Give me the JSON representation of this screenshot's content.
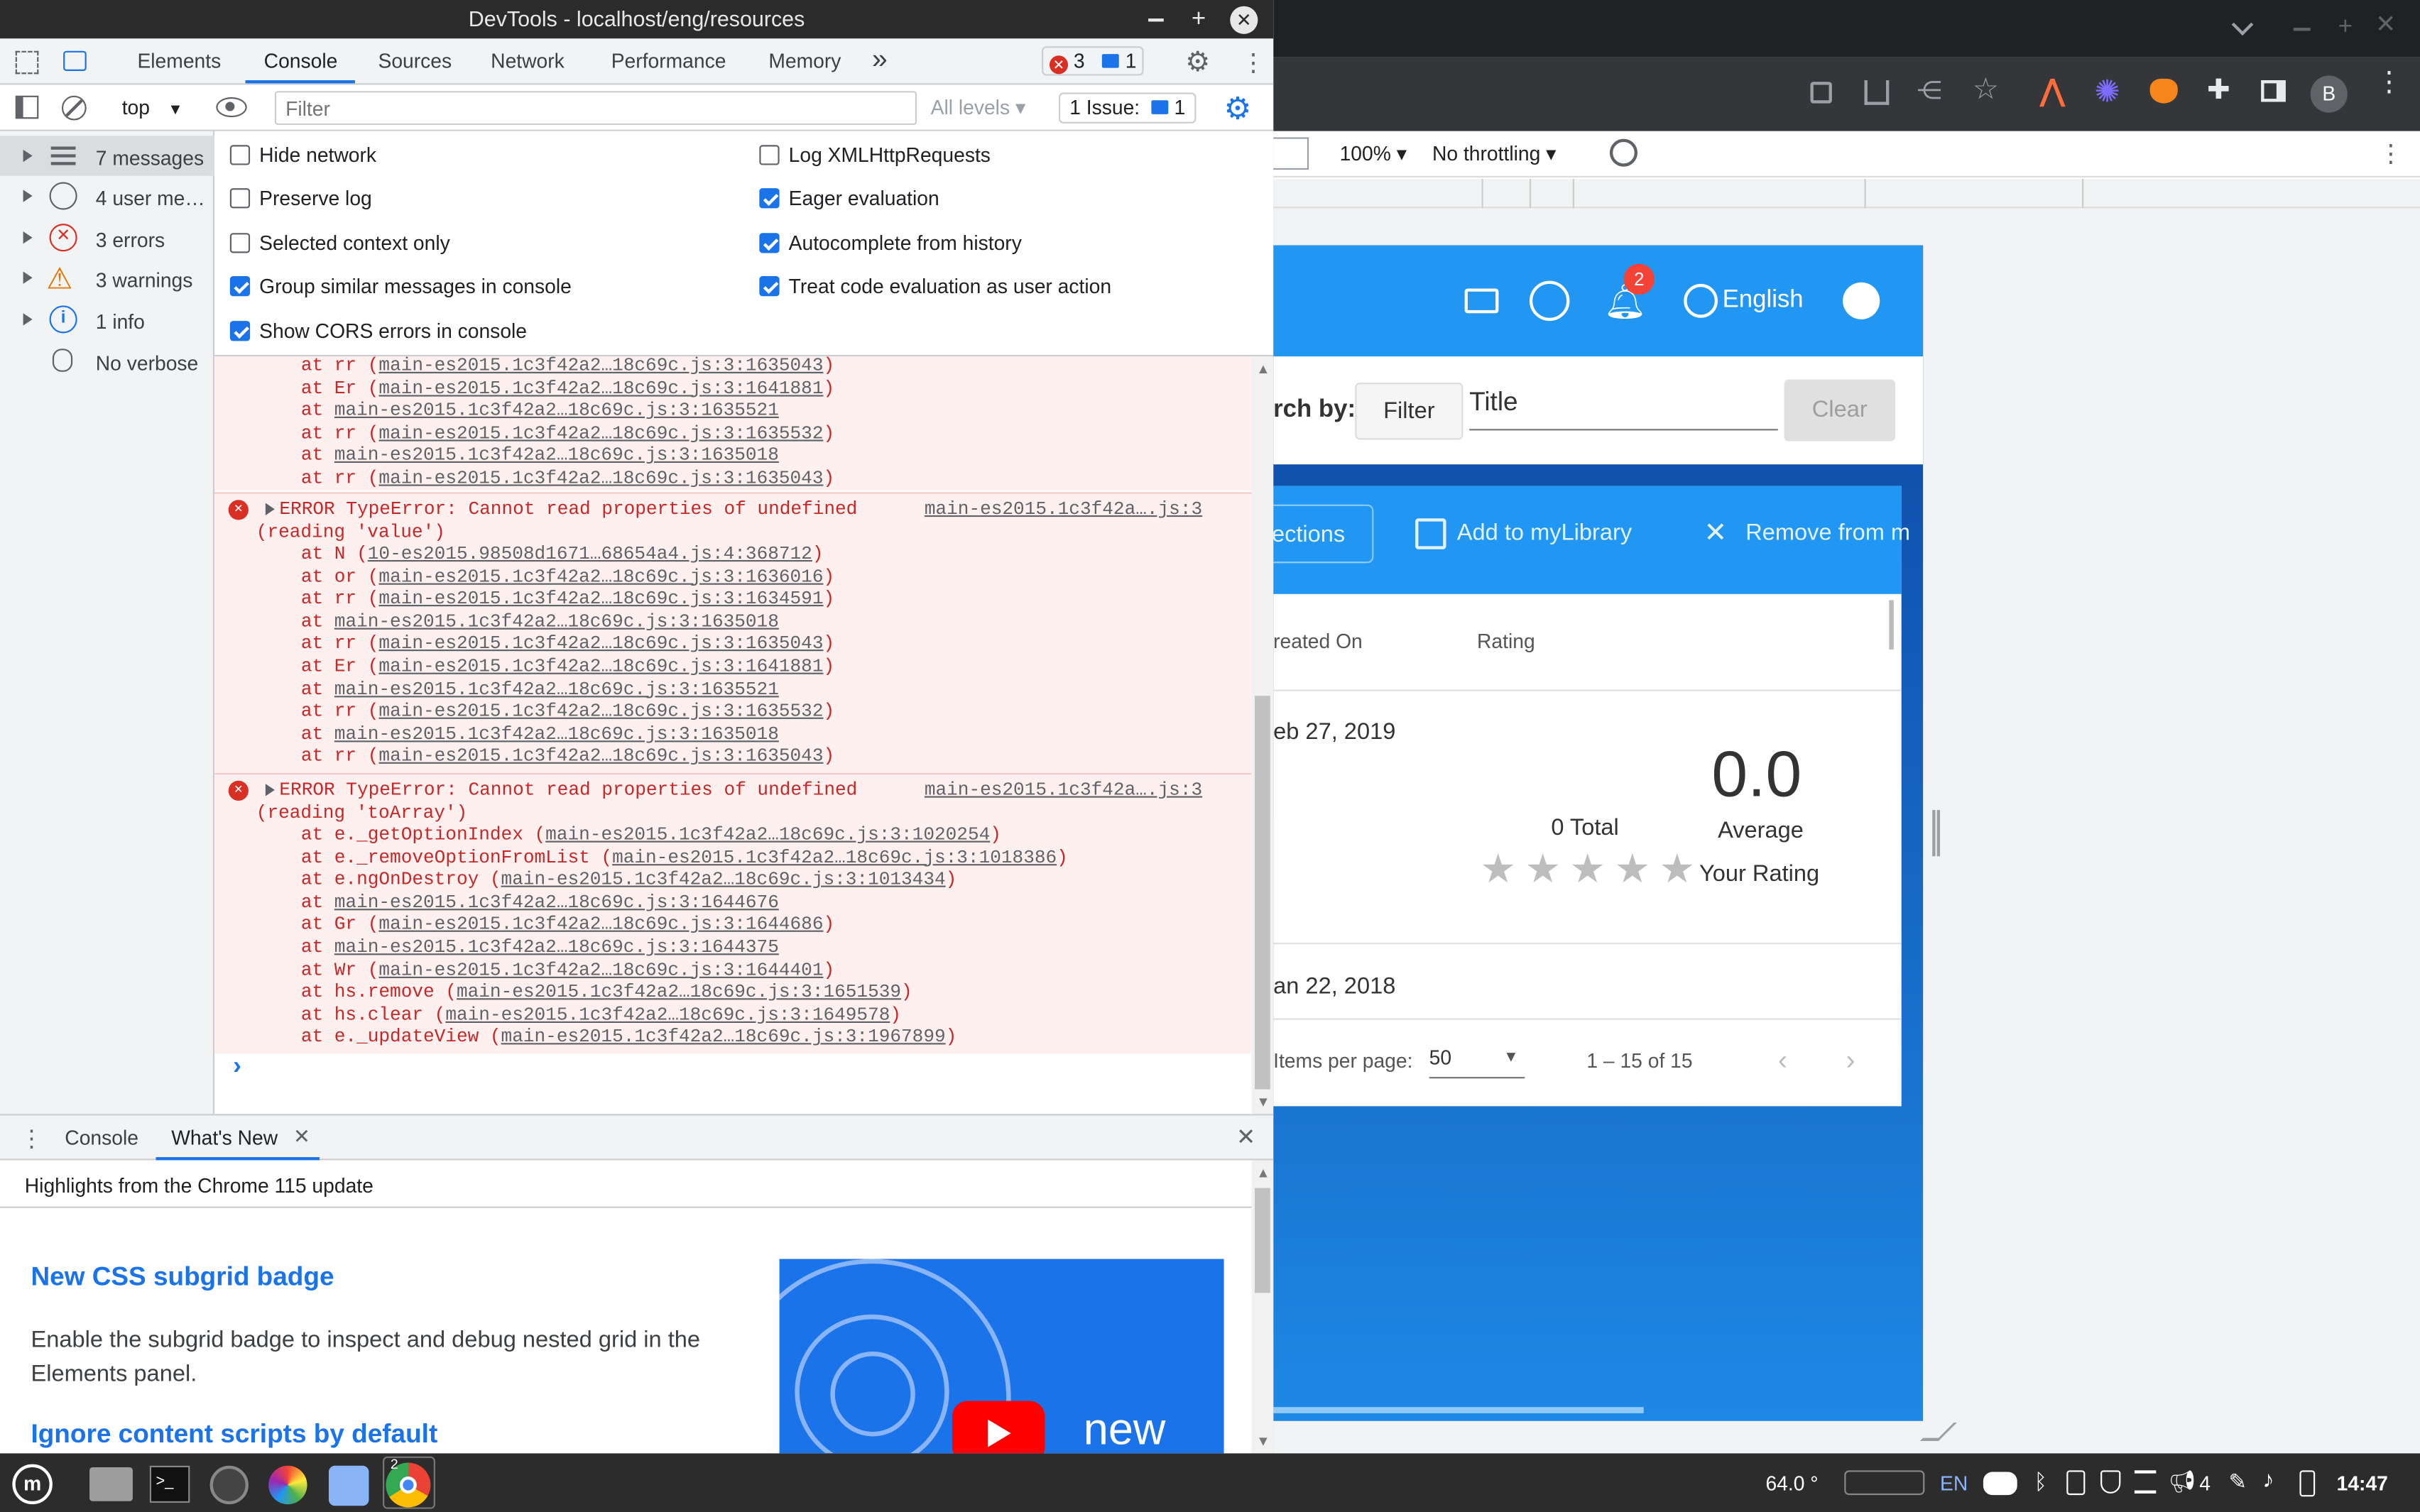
{
  "devtools": {
    "title": "DevTools - localhost/eng/resources",
    "tabs": [
      "Elements",
      "Console",
      "Sources",
      "Network",
      "Performance",
      "Memory"
    ],
    "active_tab": "Console",
    "more_tabs": "»",
    "error_count": "3",
    "message_count": "1",
    "context": "top",
    "filter_placeholder": "Filter",
    "levels": "All levels",
    "issues_label": "1 Issue:",
    "issues_count": "1",
    "sidebar": [
      {
        "label": "7 messages",
        "icon": "list-icon"
      },
      {
        "label": "4 user me…",
        "icon": "user-icon"
      },
      {
        "label": "3 errors",
        "icon": "error-icon"
      },
      {
        "label": "3 warnings",
        "icon": "warning-icon"
      },
      {
        "label": "1 info",
        "icon": "info-icon"
      },
      {
        "label": "No verbose",
        "icon": "bug-icon"
      }
    ],
    "settings_left": [
      {
        "label": "Hide network",
        "checked": false
      },
      {
        "label": "Preserve log",
        "checked": false
      },
      {
        "label": "Selected context only",
        "checked": false
      },
      {
        "label": "Group similar messages in console",
        "checked": true
      },
      {
        "label": "Show CORS errors in console",
        "checked": true
      }
    ],
    "settings_right": [
      {
        "label": "Log XMLHttpRequests",
        "checked": false
      },
      {
        "label": "Eager evaluation",
        "checked": true
      },
      {
        "label": "Autocomplete from history",
        "checked": true
      },
      {
        "label": "Treat code evaluation as user action",
        "checked": true
      }
    ],
    "log": {
      "trailing_stack": [
        [
          "at rr (",
          "main-es2015.1c3f42a2…18c69c.js:3:1635043",
          ")"
        ],
        [
          "at Er (",
          "main-es2015.1c3f42a2…18c69c.js:3:1641881",
          ")"
        ],
        [
          "at ",
          "main-es2015.1c3f42a2…18c69c.js:3:1635521",
          ""
        ],
        [
          "at rr (",
          "main-es2015.1c3f42a2…18c69c.js:3:1635532",
          ")"
        ],
        [
          "at ",
          "main-es2015.1c3f42a2…18c69c.js:3:1635018",
          ""
        ],
        [
          "at rr (",
          "main-es2015.1c3f42a2…18c69c.js:3:1635043",
          ")"
        ]
      ],
      "error1": {
        "line1": "ERROR TypeError: Cannot read properties of undefined",
        "line2": "(reading 'value')",
        "source": "main-es2015.1c3f42a….js:3",
        "stack": [
          [
            "at N (",
            "10-es2015.98508d1671…68654a4.js:4:368712",
            ")"
          ],
          [
            "at or (",
            "main-es2015.1c3f42a2…18c69c.js:3:1636016",
            ")"
          ],
          [
            "at rr (",
            "main-es2015.1c3f42a2…18c69c.js:3:1634591",
            ")"
          ],
          [
            "at ",
            "main-es2015.1c3f42a2…18c69c.js:3:1635018",
            ""
          ],
          [
            "at rr (",
            "main-es2015.1c3f42a2…18c69c.js:3:1635043",
            ")"
          ],
          [
            "at Er (",
            "main-es2015.1c3f42a2…18c69c.js:3:1641881",
            ")"
          ],
          [
            "at ",
            "main-es2015.1c3f42a2…18c69c.js:3:1635521",
            ""
          ],
          [
            "at rr (",
            "main-es2015.1c3f42a2…18c69c.js:3:1635532",
            ")"
          ],
          [
            "at ",
            "main-es2015.1c3f42a2…18c69c.js:3:1635018",
            ""
          ],
          [
            "at rr (",
            "main-es2015.1c3f42a2…18c69c.js:3:1635043",
            ")"
          ]
        ]
      },
      "error2": {
        "line1": "ERROR TypeError: Cannot read properties of undefined",
        "line2": "(reading 'toArray')",
        "source": "main-es2015.1c3f42a….js:3",
        "stack": [
          [
            "at e._getOptionIndex (",
            "main-es2015.1c3f42a2…18c69c.js:3:1020254",
            ")"
          ],
          [
            "at e._removeOptionFromList (",
            "main-es2015.1c3f42a2…18c69c.js:3:1018386",
            ")"
          ],
          [
            "at e.ngOnDestroy (",
            "main-es2015.1c3f42a2…18c69c.js:3:1013434",
            ")"
          ],
          [
            "at ",
            "main-es2015.1c3f42a2…18c69c.js:3:1644676",
            ""
          ],
          [
            "at Gr (",
            "main-es2015.1c3f42a2…18c69c.js:3:1644686",
            ")"
          ],
          [
            "at ",
            "main-es2015.1c3f42a2…18c69c.js:3:1644375",
            ""
          ],
          [
            "at Wr (",
            "main-es2015.1c3f42a2…18c69c.js:3:1644401",
            ")"
          ],
          [
            "at hs.remove (",
            "main-es2015.1c3f42a2…18c69c.js:3:1651539",
            ")"
          ],
          [
            "at hs.clear (",
            "main-es2015.1c3f42a2…18c69c.js:3:1649578",
            ")"
          ],
          [
            "at e._updateView (",
            "main-es2015.1c3f42a2…18c69c.js:3:1967899",
            ")"
          ]
        ]
      },
      "prompt": "›"
    },
    "drawer": {
      "tabs": [
        "Console",
        "What's New"
      ],
      "subtitle": "Highlights from the Chrome 115 update",
      "headline1": "New CSS subgrid badge",
      "body1": "Enable the subgrid badge to inspect and debug nested grid in the Elements panel.",
      "headline2": "Ignore content scripts by default",
      "video_caption": "new"
    }
  },
  "browser": {
    "zoom": "100%",
    "throttling": "No throttling",
    "profile_initial": "B",
    "app": {
      "notification_count": "2",
      "language": "English",
      "search_by": "rch by:",
      "filter_button": "Filter",
      "title_field": "Title",
      "clear_button": "Clear",
      "toolbar": {
        "collections": "ections",
        "add_to_library": "Add to myLibrary",
        "remove_from": "Remove from m"
      },
      "columns": {
        "created_on": "reated On",
        "rating": "Rating"
      },
      "rows": [
        {
          "date": "eb 27, 2019",
          "total": "0 Total",
          "average_value": "0.0",
          "average_label": "Average",
          "your_rating": "Your Rating"
        },
        {
          "date": "an 22, 2018"
        }
      ],
      "paginator": {
        "label": "Items per page:",
        "size": "50",
        "range": "1 – 15 of 15"
      }
    }
  },
  "taskbar": {
    "temperature": "64.0 °",
    "language": "EN",
    "battery_count": "4",
    "time": "14:47",
    "chrome_window_count": "2"
  },
  "colors": {
    "app_blue": "#2196f3",
    "error_red": "#c62828",
    "devtools_blue": "#1a73e8"
  }
}
